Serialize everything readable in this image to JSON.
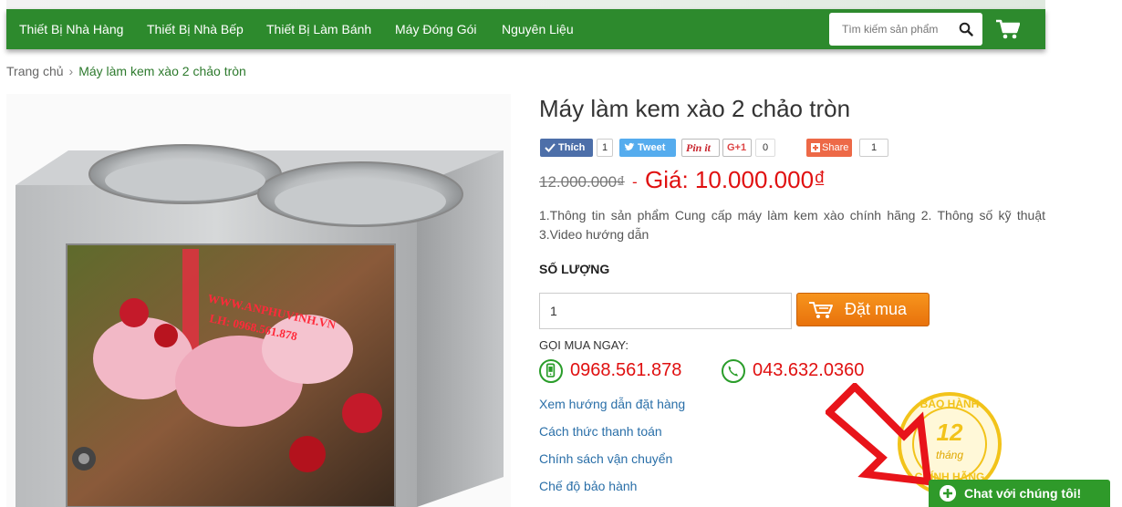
{
  "nav": {
    "items": [
      "Thiết Bị Nhà Hàng",
      "Thiết Bị Nhà Bếp",
      "Thiết Bị Làm Bánh",
      "Máy Đóng Gói",
      "Nguyên Liệu"
    ],
    "search_placeholder": "Tìm kiếm sản phẩm"
  },
  "breadcrumb": {
    "home": "Trang chủ",
    "separator": "›",
    "current": "Máy làm kem xào 2 chảo tròn"
  },
  "product": {
    "title": "Máy làm kem xào 2 chảo tròn",
    "image_watermark": "WWW.ANPHUVINH.VN",
    "image_phone": "LH: 0968.561.878",
    "old_price": "12.000.000₫",
    "price_dash": "-",
    "price": "Giá: 10.000.000₫",
    "description": "1.Thông tin sản phẩm Cung cấp máy làm kem xào chính hãng 2. Thông số kỹ thuật 3.Video hướng dẫn",
    "quantity_label": "SỐ LƯỢNG",
    "quantity_value": "1",
    "buy_label": "Đặt mua"
  },
  "social": {
    "like_label": "Thích",
    "like_count": "1",
    "tweet_label": "Tweet",
    "tweet_count": "",
    "pin_label": "Pin it",
    "gplus_label": "G+1",
    "gplus_count": "0",
    "share_label": "Share",
    "share_count": "1"
  },
  "contact": {
    "call_label": "GỌI MUA NGAY:",
    "mobile": "0968.561.878",
    "landline": "043.632.0360"
  },
  "links": [
    "Xem hướng dẫn đặt hàng",
    "Cách thức thanh toán",
    "Chính sách vận chuyển",
    "Chế độ bảo hành"
  ],
  "warranty_badge": {
    "top": "BẢO HÀNH",
    "number": "12",
    "unit": "tháng",
    "bottom": "CHÍNH HÃNG"
  },
  "chat": {
    "label": "Chat với chúng tôi!"
  },
  "colors": {
    "nav": "#2d8a2d",
    "price": "#e01010",
    "buy": "#f7941d",
    "link": "#2a6fa8",
    "chat": "#2f9a2a"
  }
}
